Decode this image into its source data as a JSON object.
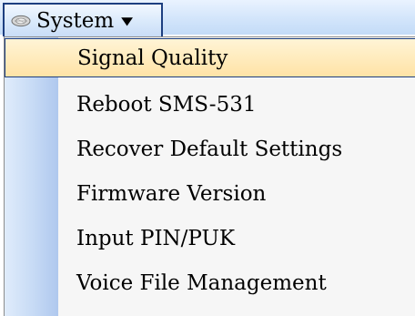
{
  "menu": {
    "title": "System",
    "icon": "system-menu-icon",
    "caret_icon": "dropdown-arrow-icon"
  },
  "dropdown": {
    "items": [
      {
        "label": "Signal Quality",
        "selected": true
      },
      {
        "label": "Reboot SMS-531",
        "selected": false
      },
      {
        "label": "Recover Default Settings",
        "selected": false
      },
      {
        "label": "Firmware Version",
        "selected": false
      },
      {
        "label": "Input PIN/PUK",
        "selected": false
      },
      {
        "label": "Voice File Management",
        "selected": false
      }
    ]
  },
  "colors": {
    "selection_background": "#ffe3a6",
    "selection_border": "#1d3f80",
    "menu_background": "#f6f6f6",
    "gutter": "#c6daf5"
  }
}
